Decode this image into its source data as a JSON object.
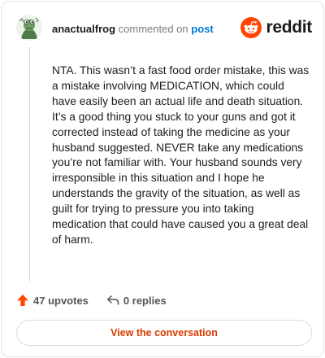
{
  "header": {
    "username": "anactualfrog",
    "action": "commented on",
    "post_link": "post",
    "brand": "reddit"
  },
  "comment": {
    "text": "NTA. This wasn’t a fast food order mistake, this was a mistake involving MEDICATION, which could have easily been an actual life and death situation. It’s a good thing you stuck to your guns and got it corrected instead of taking the medicine as your husband suggested. NEVER take any medications you’re not familiar with. Your husband sounds very irresponsible in this situation and I hope he understands the gravity of the situation, as well as guilt for trying to pressure you into taking medication that could have caused you a great deal of harm."
  },
  "actions": {
    "upvotes": "47 upvotes",
    "replies": "0 replies"
  },
  "button": {
    "view_label": "View the conversation"
  },
  "colors": {
    "accent": "#ff4500",
    "link": "#0079d3",
    "button_text": "#d93a00"
  },
  "icons": {
    "avatar": "frog-avatar",
    "logo": "reddit-snoo-icon",
    "upvote": "upvote-arrow-icon",
    "reply": "reply-arrow-icon"
  }
}
